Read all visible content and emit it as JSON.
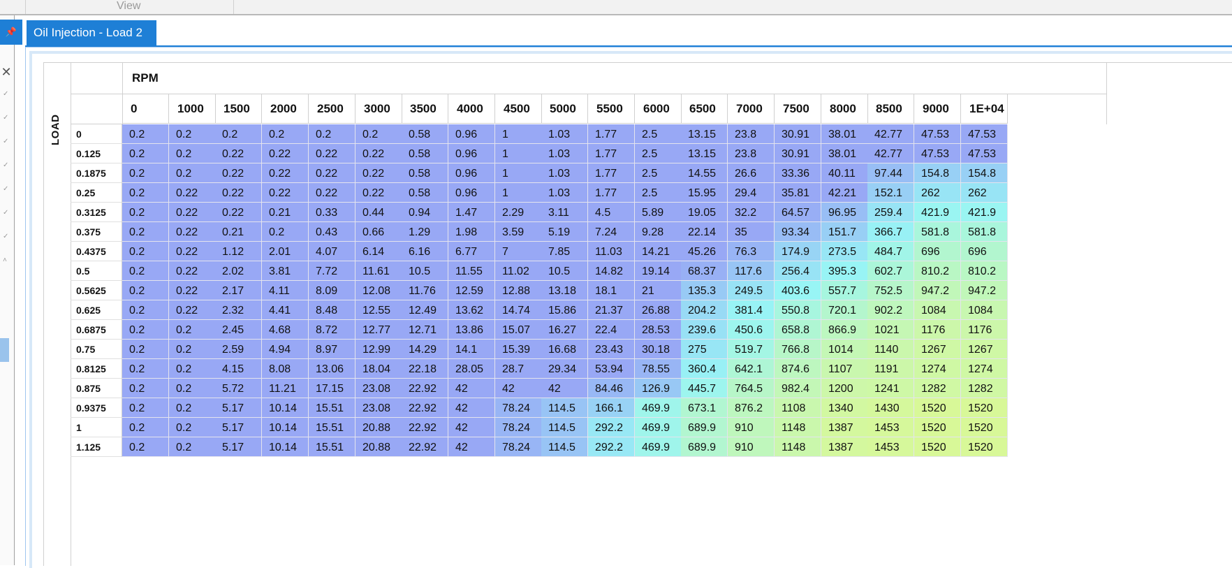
{
  "menu": {
    "view_label": "View"
  },
  "dock": {
    "pin_icon": "pin-icon",
    "close_icon": "close-icon"
  },
  "tab": {
    "title": "Oil Injection - Load 2"
  },
  "table": {
    "column_axis_label": "RPM",
    "row_axis_label": "LOAD",
    "columns": [
      "0",
      "1000",
      "1500",
      "2000",
      "2500",
      "3000",
      "3500",
      "4000",
      "4500",
      "5000",
      "5500",
      "6000",
      "6500",
      "7000",
      "7500",
      "8000",
      "8500",
      "9000",
      "1E+04"
    ],
    "rows": [
      {
        "load": "0",
        "values": [
          "0.2",
          "0.2",
          "0.2",
          "0.2",
          "0.2",
          "0.2",
          "0.58",
          "0.96",
          "1",
          "1.03",
          "1.77",
          "2.5",
          "13.15",
          "23.8",
          "30.91",
          "38.01",
          "42.77",
          "47.53",
          "47.53"
        ]
      },
      {
        "load": "0.125",
        "values": [
          "0.2",
          "0.2",
          "0.22",
          "0.22",
          "0.22",
          "0.22",
          "0.58",
          "0.96",
          "1",
          "1.03",
          "1.77",
          "2.5",
          "13.15",
          "23.8",
          "30.91",
          "38.01",
          "42.77",
          "47.53",
          "47.53"
        ]
      },
      {
        "load": "0.1875",
        "values": [
          "0.2",
          "0.2",
          "0.22",
          "0.22",
          "0.22",
          "0.22",
          "0.58",
          "0.96",
          "1",
          "1.03",
          "1.77",
          "2.5",
          "14.55",
          "26.6",
          "33.36",
          "40.11",
          "97.44",
          "154.8",
          "154.8"
        ]
      },
      {
        "load": "0.25",
        "values": [
          "0.2",
          "0.22",
          "0.22",
          "0.22",
          "0.22",
          "0.22",
          "0.58",
          "0.96",
          "1",
          "1.03",
          "1.77",
          "2.5",
          "15.95",
          "29.4",
          "35.81",
          "42.21",
          "152.1",
          "262",
          "262"
        ]
      },
      {
        "load": "0.3125",
        "values": [
          "0.2",
          "0.22",
          "0.22",
          "0.21",
          "0.33",
          "0.44",
          "0.94",
          "1.47",
          "2.29",
          "3.11",
          "4.5",
          "5.89",
          "19.05",
          "32.2",
          "64.57",
          "96.95",
          "259.4",
          "421.9",
          "421.9"
        ]
      },
      {
        "load": "0.375",
        "values": [
          "0.2",
          "0.22",
          "0.21",
          "0.2",
          "0.43",
          "0.66",
          "1.29",
          "1.98",
          "3.59",
          "5.19",
          "7.24",
          "9.28",
          "22.14",
          "35",
          "93.34",
          "151.7",
          "366.7",
          "581.8",
          "581.8"
        ]
      },
      {
        "load": "0.4375",
        "values": [
          "0.2",
          "0.22",
          "1.12",
          "2.01",
          "4.07",
          "6.14",
          "6.16",
          "6.77",
          "7",
          "7.85",
          "11.03",
          "14.21",
          "45.26",
          "76.3",
          "174.9",
          "273.5",
          "484.7",
          "696",
          "696"
        ]
      },
      {
        "load": "0.5",
        "values": [
          "0.2",
          "0.22",
          "2.02",
          "3.81",
          "7.72",
          "11.61",
          "10.5",
          "11.55",
          "11.02",
          "10.5",
          "14.82",
          "19.14",
          "68.37",
          "117.6",
          "256.4",
          "395.3",
          "602.7",
          "810.2",
          "810.2"
        ]
      },
      {
        "load": "0.5625",
        "values": [
          "0.2",
          "0.22",
          "2.17",
          "4.11",
          "8.09",
          "12.08",
          "11.76",
          "12.59",
          "12.88",
          "13.18",
          "18.1",
          "21",
          "135.3",
          "249.5",
          "403.6",
          "557.7",
          "752.5",
          "947.2",
          "947.2"
        ]
      },
      {
        "load": "0.625",
        "values": [
          "0.2",
          "0.22",
          "2.32",
          "4.41",
          "8.48",
          "12.55",
          "12.49",
          "13.62",
          "14.74",
          "15.86",
          "21.37",
          "26.88",
          "204.2",
          "381.4",
          "550.8",
          "720.1",
          "902.2",
          "1084",
          "1084"
        ]
      },
      {
        "load": "0.6875",
        "values": [
          "0.2",
          "0.2",
          "2.45",
          "4.68",
          "8.72",
          "12.77",
          "12.71",
          "13.86",
          "15.07",
          "16.27",
          "22.4",
          "28.53",
          "239.6",
          "450.6",
          "658.8",
          "866.9",
          "1021",
          "1176",
          "1176"
        ]
      },
      {
        "load": "0.75",
        "values": [
          "0.2",
          "0.2",
          "2.59",
          "4.94",
          "8.97",
          "12.99",
          "14.29",
          "14.1",
          "15.39",
          "16.68",
          "23.43",
          "30.18",
          "275",
          "519.7",
          "766.8",
          "1014",
          "1140",
          "1267",
          "1267"
        ]
      },
      {
        "load": "0.8125",
        "values": [
          "0.2",
          "0.2",
          "4.15",
          "8.08",
          "13.06",
          "18.04",
          "22.18",
          "28.05",
          "28.7",
          "29.34",
          "53.94",
          "78.55",
          "360.4",
          "642.1",
          "874.6",
          "1107",
          "1191",
          "1274",
          "1274"
        ]
      },
      {
        "load": "0.875",
        "values": [
          "0.2",
          "0.2",
          "5.72",
          "11.21",
          "17.15",
          "23.08",
          "22.92",
          "42",
          "42",
          "42",
          "84.46",
          "126.9",
          "445.7",
          "764.5",
          "982.4",
          "1200",
          "1241",
          "1282",
          "1282"
        ]
      },
      {
        "load": "0.9375",
        "values": [
          "0.2",
          "0.2",
          "5.17",
          "10.14",
          "15.51",
          "23.08",
          "22.92",
          "42",
          "78.24",
          "114.5",
          "166.1",
          "469.9",
          "673.1",
          "876.2",
          "1108",
          "1340",
          "1430",
          "1520",
          "1520"
        ]
      },
      {
        "load": "1",
        "values": [
          "0.2",
          "0.2",
          "5.17",
          "10.14",
          "15.51",
          "20.88",
          "22.92",
          "42",
          "78.24",
          "114.5",
          "292.2",
          "469.9",
          "689.9",
          "910",
          "1148",
          "1387",
          "1453",
          "1520",
          "1520"
        ]
      },
      {
        "load": "1.125",
        "values": [
          "0.2",
          "0.2",
          "5.17",
          "10.14",
          "15.51",
          "20.88",
          "22.92",
          "42",
          "78.24",
          "114.5",
          "292.2",
          "469.9",
          "689.9",
          "910",
          "1148",
          "1387",
          "1453",
          "1520",
          "1520"
        ]
      }
    ]
  },
  "colors": {
    "accent": "#1e7fd6",
    "heat_low": "#98a8f5",
    "heat_mid": "#98f5f5",
    "heat_high": "#d8f898"
  }
}
